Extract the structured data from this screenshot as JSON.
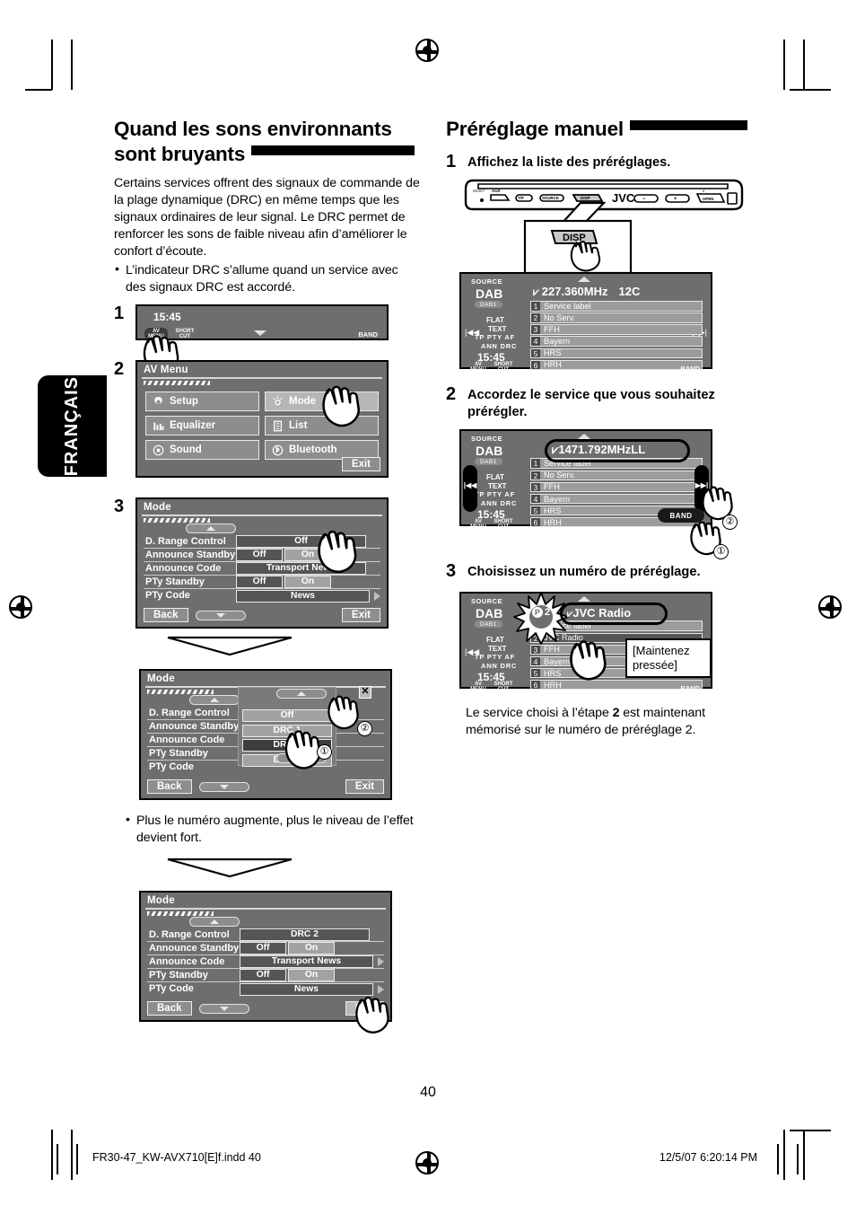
{
  "page": {
    "number": "40",
    "language_tab": "FRANÇAIS",
    "footer_left": "FR30-47_KW-AVX710[E]f.indd   40",
    "footer_right": "12/5/07   6:20:14 PM"
  },
  "left_column": {
    "heading": "Quand les sons environnants sont bruyants",
    "paragraph": "Certains services offrent des signaux de commande de la plage dynamique (DRC) en même temps que les signaux ordinaires de leur signal. Le DRC permet de renforcer les sons de faible niveau afin d’améliorer le confort d’écoute.",
    "bullets": [
      "L’indicateur DRC s’allume quand un service avec des signaux DRC est accordé."
    ],
    "steps": [
      "1",
      "2",
      "3"
    ],
    "note_bullet": "Plus le numéro augmente, plus le niveau de l’effet devient fort."
  },
  "screen_clock": {
    "time": "15:45",
    "av_menu_line1": "AV",
    "av_menu_line2": "MENU",
    "shortcut_line1": "SHORT",
    "shortcut_line2": "CUT",
    "band_label": "BAND"
  },
  "av_menu": {
    "title": "AV Menu",
    "items": [
      {
        "label": "Setup",
        "icon": "gear-icon"
      },
      {
        "label": "Mode",
        "icon": "sun-mode-icon"
      },
      {
        "label": "Equalizer",
        "icon": "equalizer-icon"
      },
      {
        "label": "List",
        "icon": "list-icon"
      },
      {
        "label": "Sound",
        "icon": "sound-icon"
      },
      {
        "label": "Bluetooth",
        "icon": "bluetooth-icon"
      }
    ],
    "exit_label": "Exit"
  },
  "mode_screen_1": {
    "title": "Mode",
    "rows": [
      {
        "label": "D. Range Control",
        "type": "single",
        "values": [
          "Off"
        ],
        "selected": 0,
        "arrow": false
      },
      {
        "label": "Announce Standby",
        "type": "pair",
        "values": [
          "Off",
          "On"
        ],
        "selected": 0,
        "arrow": false
      },
      {
        "label": "Announce Code",
        "type": "single",
        "values": [
          "Transport News"
        ],
        "selected": 0,
        "arrow": false
      },
      {
        "label": "PTy Standby",
        "type": "pair",
        "values": [
          "Off",
          "On"
        ],
        "selected": 0,
        "arrow": false
      },
      {
        "label": "PTy Code",
        "type": "single",
        "values": [
          "News"
        ],
        "selected": 0,
        "arrow": true
      }
    ],
    "back_label": "Back",
    "exit_label": "Exit"
  },
  "mode_screen_2": {
    "title": "Mode",
    "rows": [
      {
        "label": "D. Range Control"
      },
      {
        "label": "Announce Standby"
      },
      {
        "label": "Announce Code"
      },
      {
        "label": "PTy Standby"
      },
      {
        "label": "PTy Code"
      }
    ],
    "popup_options": [
      "Off",
      "DRC 1",
      "DRC 2",
      "DRC 3"
    ],
    "popup_selected": "DRC 2",
    "close_glyph": "✕",
    "marker_1": "①",
    "marker_2": "②",
    "back_label": "Back",
    "exit_label": "Exit"
  },
  "mode_screen_3": {
    "title": "Mode",
    "rows": [
      {
        "label": "D. Range Control",
        "type": "single",
        "values": [
          "DRC 2"
        ],
        "selected": 0,
        "arrow": false
      },
      {
        "label": "Announce Standby",
        "type": "pair",
        "values": [
          "Off",
          "On"
        ],
        "selected": 0,
        "arrow": false
      },
      {
        "label": "Announce Code",
        "type": "single",
        "values": [
          "Transport News"
        ],
        "selected": 0,
        "arrow": true
      },
      {
        "label": "PTy Standby",
        "type": "pair",
        "values": [
          "Off",
          "On"
        ],
        "selected": 0,
        "arrow": false
      },
      {
        "label": "PTy Code",
        "type": "single",
        "values": [
          "News"
        ],
        "selected": 0,
        "arrow": true
      }
    ],
    "back_label": "Back",
    "exit_label": "Exit"
  },
  "right_column": {
    "heading": "Préréglage manuel",
    "step1": {
      "num": "1",
      "text": "Affichez la liste des préréglages."
    },
    "step2": {
      "num": "2",
      "text": "Accordez le service que vous souhaitez prérégler."
    },
    "step3": {
      "num": "3",
      "text": "Choisissez un numéro de préréglage."
    },
    "closing": "Le service choisi à l’étape 2 est maintenant mémorisé sur le numéro de préréglage 2.",
    "closing_part1": "Le service choisi à l’étape ",
    "closing_bold": "2",
    "closing_part2": " est maintenant mémorisé sur le numéro de préréglage 2.",
    "disp_button": "DISP",
    "brand": "JVC",
    "faceplate_buttons": [
      "RESET",
      "AUX",
      "T/P",
      "SOURCE",
      "DISP",
      "−",
      "+",
      "0 OPEN"
    ]
  },
  "dab_screen_1": {
    "source_label": "SOURCE",
    "band": "DAB",
    "band_sub": "DAB1",
    "flat": "FLAT",
    "text": "TEXT",
    "tppty": "TP  PTY  AF",
    "ann": "ANN   DRC",
    "clock": "15:45",
    "frequency": "227.360MHz",
    "ensemble": "12C",
    "presets": [
      {
        "n": "1",
        "label": "Service label"
      },
      {
        "n": "2",
        "label": "No Serv."
      },
      {
        "n": "3",
        "label": "FFH"
      },
      {
        "n": "4",
        "label": "Bayern"
      },
      {
        "n": "5",
        "label": "HRS"
      },
      {
        "n": "6",
        "label": "HRH"
      }
    ]
  },
  "dab_screen_2": {
    "source_label": "SOURCE",
    "band": "DAB",
    "band_sub": "DAB1",
    "clock": "15:45",
    "frequency": "1471.792MHz",
    "ensemble": "LL",
    "band_button": "BAND",
    "marker_1": "①",
    "marker_2": "②",
    "presets": [
      {
        "n": "1",
        "label": "Service label"
      },
      {
        "n": "2",
        "label": "No Serv."
      },
      {
        "n": "3",
        "label": "FFH"
      },
      {
        "n": "4",
        "label": "Bayern"
      },
      {
        "n": "5",
        "label": "HRS"
      },
      {
        "n": "6",
        "label": "HRH"
      }
    ]
  },
  "dab_screen_3": {
    "source_label": "SOURCE",
    "band": "DAB",
    "band_sub": "DAB1",
    "clock": "15:45",
    "preset_flash": "P 2",
    "service_name": "JVC Radio",
    "hold_callout": "[Maintenez pressée]",
    "presets": [
      {
        "n": "1",
        "label": "Service label"
      },
      {
        "n": "2",
        "label": "JVC Radio"
      },
      {
        "n": "3",
        "label": "FFH"
      },
      {
        "n": "4",
        "label": "Bayern"
      },
      {
        "n": "5",
        "label": "HRS"
      },
      {
        "n": "6",
        "label": "HRH"
      }
    ]
  },
  "colors": {
    "lcd_bg": "#6e6e6e",
    "lcd_item": "#9c9c9c",
    "lcd_selected": "#555555",
    "ink": "#000000"
  }
}
